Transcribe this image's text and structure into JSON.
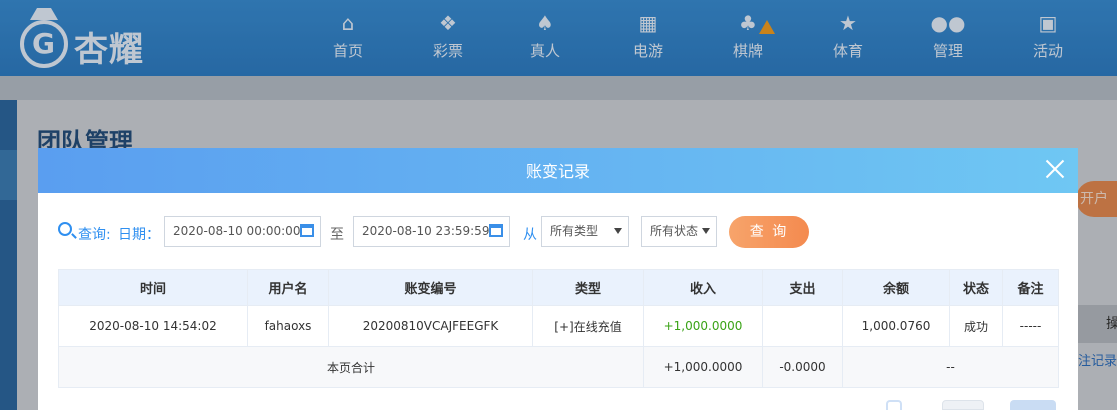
{
  "nav": {
    "logo_text": "杏耀",
    "items": [
      {
        "label": "首页",
        "icon": "home-icon"
      },
      {
        "label": "彩票",
        "icon": "lottery-icon"
      },
      {
        "label": "真人",
        "icon": "live-dealer-icon"
      },
      {
        "label": "电游",
        "icon": "slot-game-icon"
      },
      {
        "label": "棋牌",
        "icon": "card-game-icon"
      },
      {
        "label": "体育",
        "icon": "trophy-icon"
      },
      {
        "label": "管理",
        "icon": "users-icon"
      },
      {
        "label": "活动",
        "icon": "gift-icon"
      }
    ]
  },
  "page": {
    "title": "团队管理",
    "right_button": "开户",
    "right_column_head": "操",
    "right_link": "注记录"
  },
  "modal": {
    "title": "账变记录",
    "filters": {
      "query_label": "查询:",
      "date_label": "日期：",
      "start_date": "2020-08-10 00:00:00",
      "to_label": "至",
      "end_date": "2020-08-10 23:59:59",
      "from_label": "从",
      "type_select": "所有类型",
      "status_select": "所有状态",
      "query_button": "查 询"
    },
    "table": {
      "headers": [
        "时间",
        "用户名",
        "账变编号",
        "类型",
        "收入",
        "支出",
        "余额",
        "状态",
        "备注"
      ],
      "rows": [
        [
          "2020-08-10 14:54:02",
          "fahaoxs",
          "20200810VCAJFEEGFK",
          "[+]在线充值",
          "+1,000.0000",
          "",
          "1,000.0760",
          "成功",
          "-----"
        ]
      ],
      "summary": {
        "label": "本页合计",
        "income": "+1,000.0000",
        "expense": "-0.0000",
        "balance": "--"
      }
    }
  },
  "colors": {
    "nav_bg": "#3a8fd6",
    "modal_header_start": "#5a9ef0",
    "modal_header_end": "#6fc7f3",
    "query_button": "#f48a4f",
    "income_green": "#3aa316",
    "accent_blue": "#2f8ff0"
  }
}
